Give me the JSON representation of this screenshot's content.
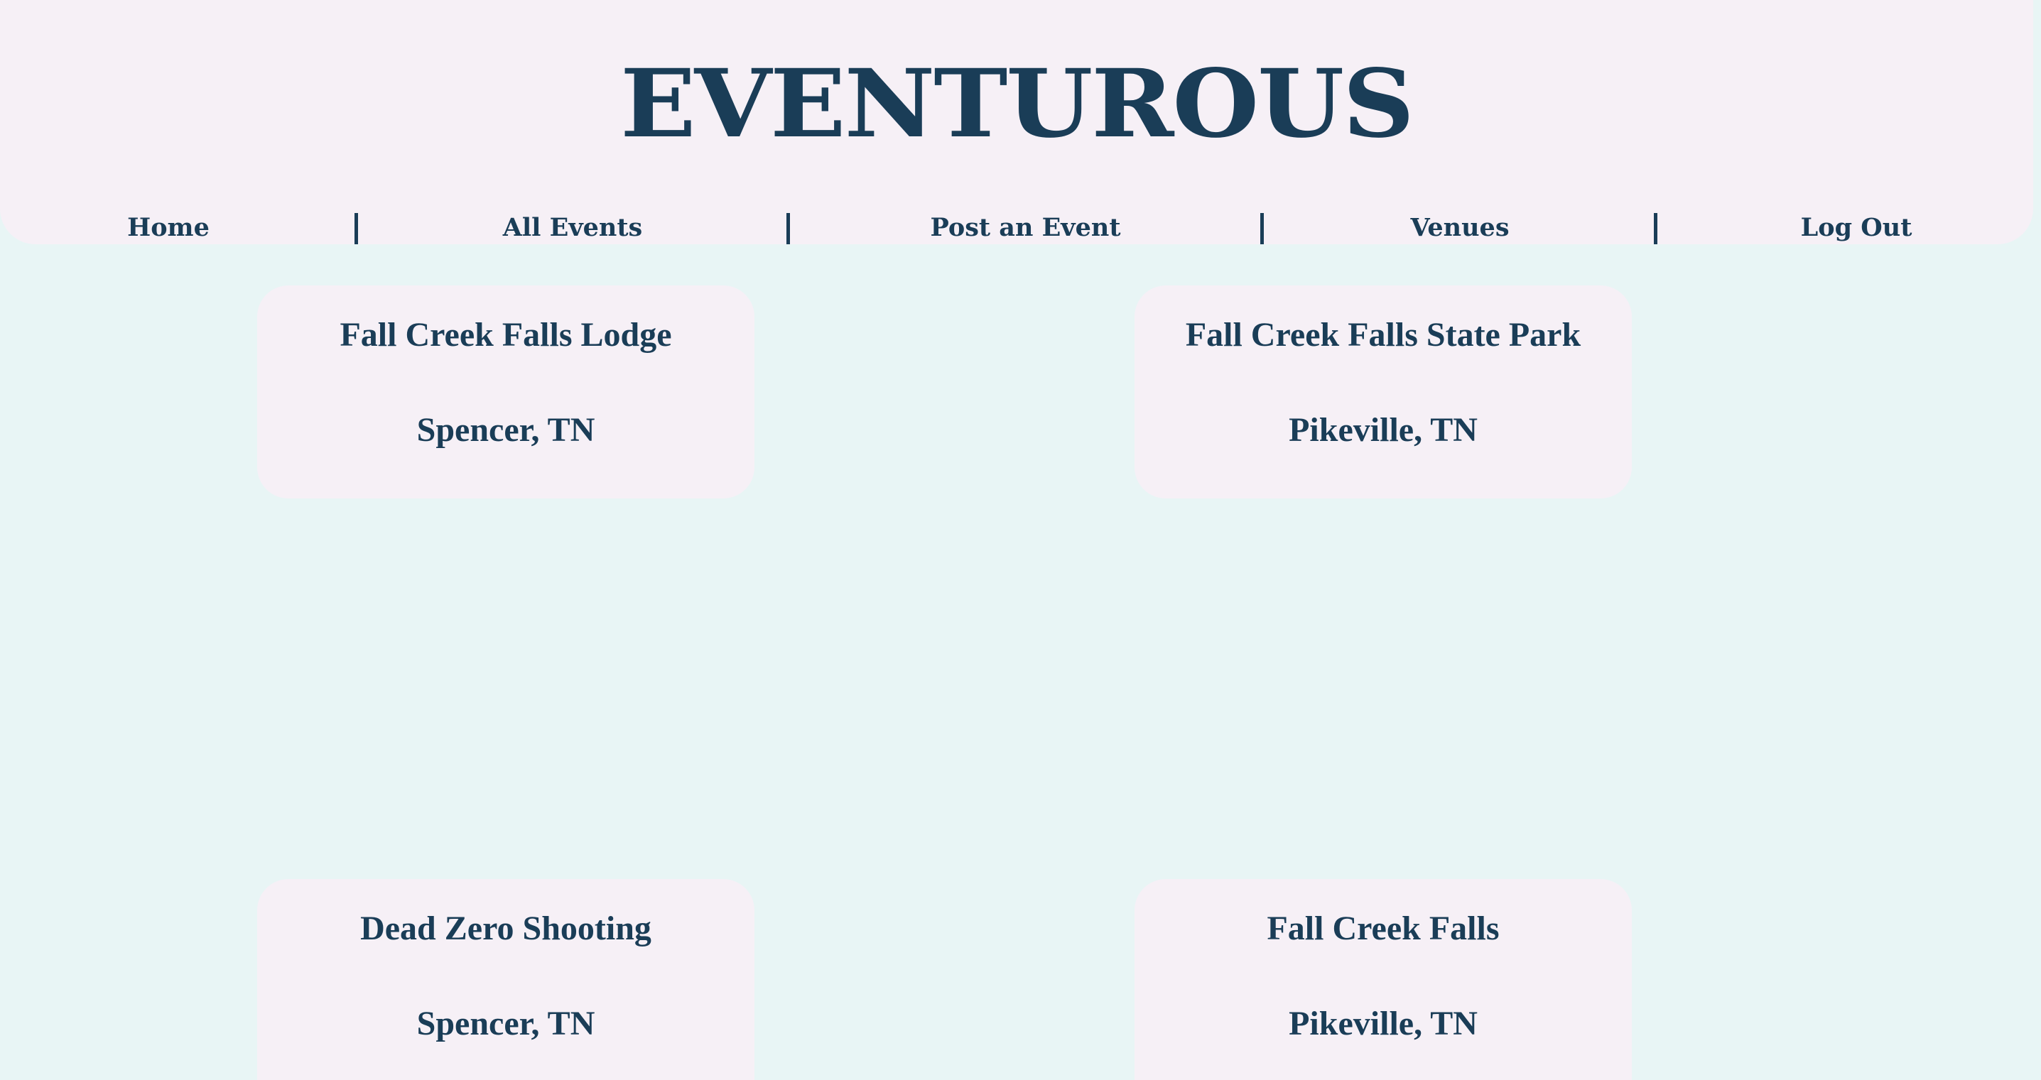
{
  "header": {
    "logo": "EVENTUROUS"
  },
  "nav": {
    "items": [
      {
        "label": "Home"
      },
      {
        "label": "All Events"
      },
      {
        "label": "Post an Event"
      },
      {
        "label": "Venues"
      },
      {
        "label": "Log Out"
      }
    ]
  },
  "venues": [
    {
      "name": "Fall Creek Falls Lodge",
      "location": "Spencer, TN"
    },
    {
      "name": "Fall Creek Falls State Park",
      "location": "Pikeville, TN"
    },
    {
      "name": "Dead Zero Shooting",
      "location": "Spencer, TN"
    },
    {
      "name": "Fall Creek Falls",
      "location": "Pikeville, TN"
    }
  ],
  "colors": {
    "page_background": "#e8f5f5",
    "panel_background": "#f6f0f6",
    "text": "#1a3d57"
  }
}
